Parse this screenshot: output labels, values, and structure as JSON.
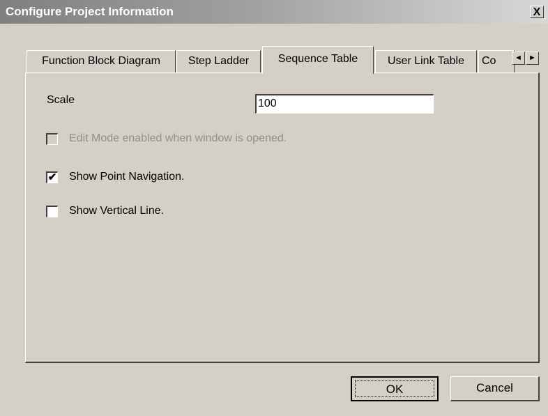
{
  "window": {
    "title": "Configure Project Information",
    "close_label": "X"
  },
  "tabs": [
    {
      "label": "Function Block Diagram"
    },
    {
      "label": "Step Ladder"
    },
    {
      "label": "Sequence Table",
      "active": true
    },
    {
      "label": "User Link Table"
    },
    {
      "label": "Co"
    }
  ],
  "tab_scroll": {
    "left": "◄",
    "right": "►"
  },
  "scale": {
    "label": "Scale",
    "value": "100"
  },
  "options": [
    {
      "label": "Edit Mode enabled when window is opened.",
      "checked": false,
      "enabled": false,
      "mark": ""
    },
    {
      "label": "Show Point Navigation.",
      "checked": true,
      "enabled": true,
      "mark": "✔"
    },
    {
      "label": "Show Vertical Line.",
      "checked": false,
      "enabled": true,
      "mark": ""
    }
  ],
  "buttons": {
    "ok": "OK",
    "cancel": "Cancel"
  }
}
